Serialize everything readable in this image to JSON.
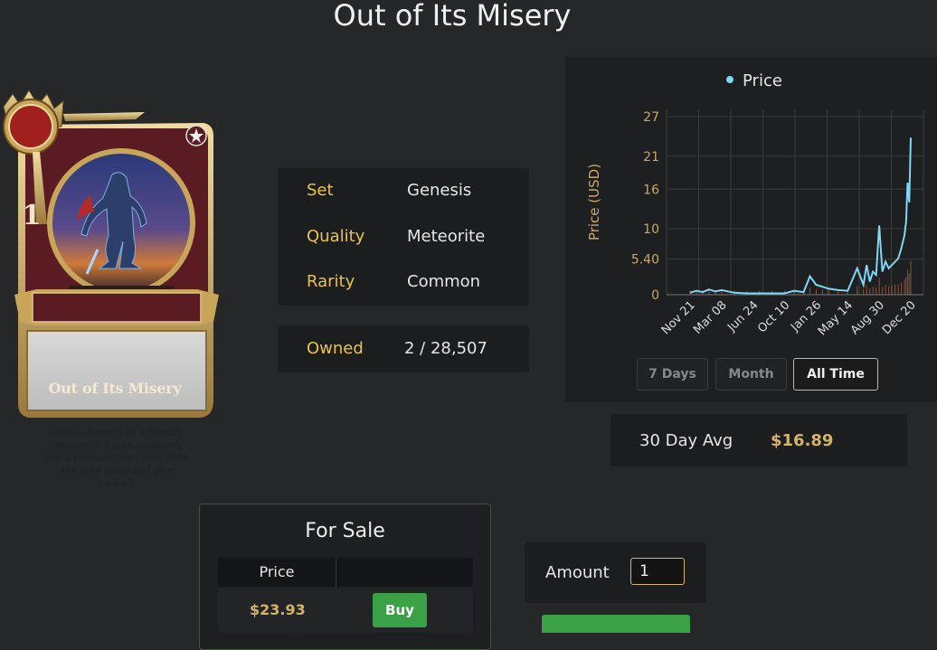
{
  "page": {
    "title": "Out of Its Misery"
  },
  "card": {
    "name": "Out of Its Misery",
    "mana_cost": "1",
    "description_lines": [
      "Deal 1 damage to a friendly",
      "creature. If it dies, randomly",
      "pull a creature from your deck",
      "into your hand and give",
      "it +3/+3."
    ],
    "frame_color": "#5a1c22",
    "accent_color": "#c9a55a"
  },
  "info": {
    "set_label": "Set",
    "set_value": "Genesis",
    "quality_label": "Quality",
    "quality_value": "Meteorite",
    "rarity_label": "Rarity",
    "rarity_value": "Common",
    "owned_label": "Owned",
    "owned_value": "2 / 28,507"
  },
  "chart_data": {
    "type": "line",
    "legend": [
      "Price"
    ],
    "ylabel": "Price (USD)",
    "xlabel": "",
    "y_ticks": [
      "0",
      "5.40",
      "10",
      "16",
      "21",
      "27"
    ],
    "x_ticks": [
      "Nov 21",
      "Mar 08",
      "Jun 24",
      "Oct 10",
      "Jan 26",
      "May 14",
      "Aug 30",
      "Dec 20"
    ],
    "ylim": [
      0,
      27
    ],
    "grid": true,
    "colors": {
      "line": "#7fd6f5",
      "volume": "#c0643a"
    },
    "series": [
      {
        "name": "Price",
        "x_index": [
          0,
          0.2,
          0.4,
          0.6,
          0.8,
          1.0,
          1.4,
          1.8,
          2.2,
          2.6,
          3.0,
          3.3,
          3.6,
          3.8,
          4.0,
          4.2,
          4.4,
          4.7,
          5.0,
          5.3,
          5.5,
          5.6,
          5.7,
          5.8,
          5.9,
          6.0,
          6.1,
          6.2,
          6.3,
          6.4,
          6.5,
          6.6,
          6.7,
          6.8,
          6.85,
          6.9,
          6.95,
          7.0
        ],
        "values": [
          0.3,
          0.6,
          0.4,
          0.8,
          0.5,
          0.7,
          0.3,
          0.2,
          0.2,
          0.2,
          0.2,
          0.6,
          0.4,
          2.8,
          1.5,
          1.2,
          0.9,
          0.7,
          0.6,
          4.0,
          1.5,
          4.5,
          2.0,
          3.5,
          3.0,
          10.5,
          3.5,
          5.0,
          4.0,
          4.5,
          5.0,
          5.5,
          7.0,
          9.0,
          11.0,
          17.0,
          14.0,
          23.8
        ]
      }
    ]
  },
  "chart_controls": {
    "range_buttons": [
      "7 Days",
      "Month",
      "All Time"
    ],
    "active_range": "All Time"
  },
  "avg": {
    "label": "30 Day Avg",
    "value": "$16.89"
  },
  "sale": {
    "title": "For Sale",
    "price_header": "Price",
    "rows": [
      {
        "price": "$23.93",
        "action": "Buy"
      }
    ]
  },
  "amount": {
    "label": "Amount",
    "value": "1"
  }
}
